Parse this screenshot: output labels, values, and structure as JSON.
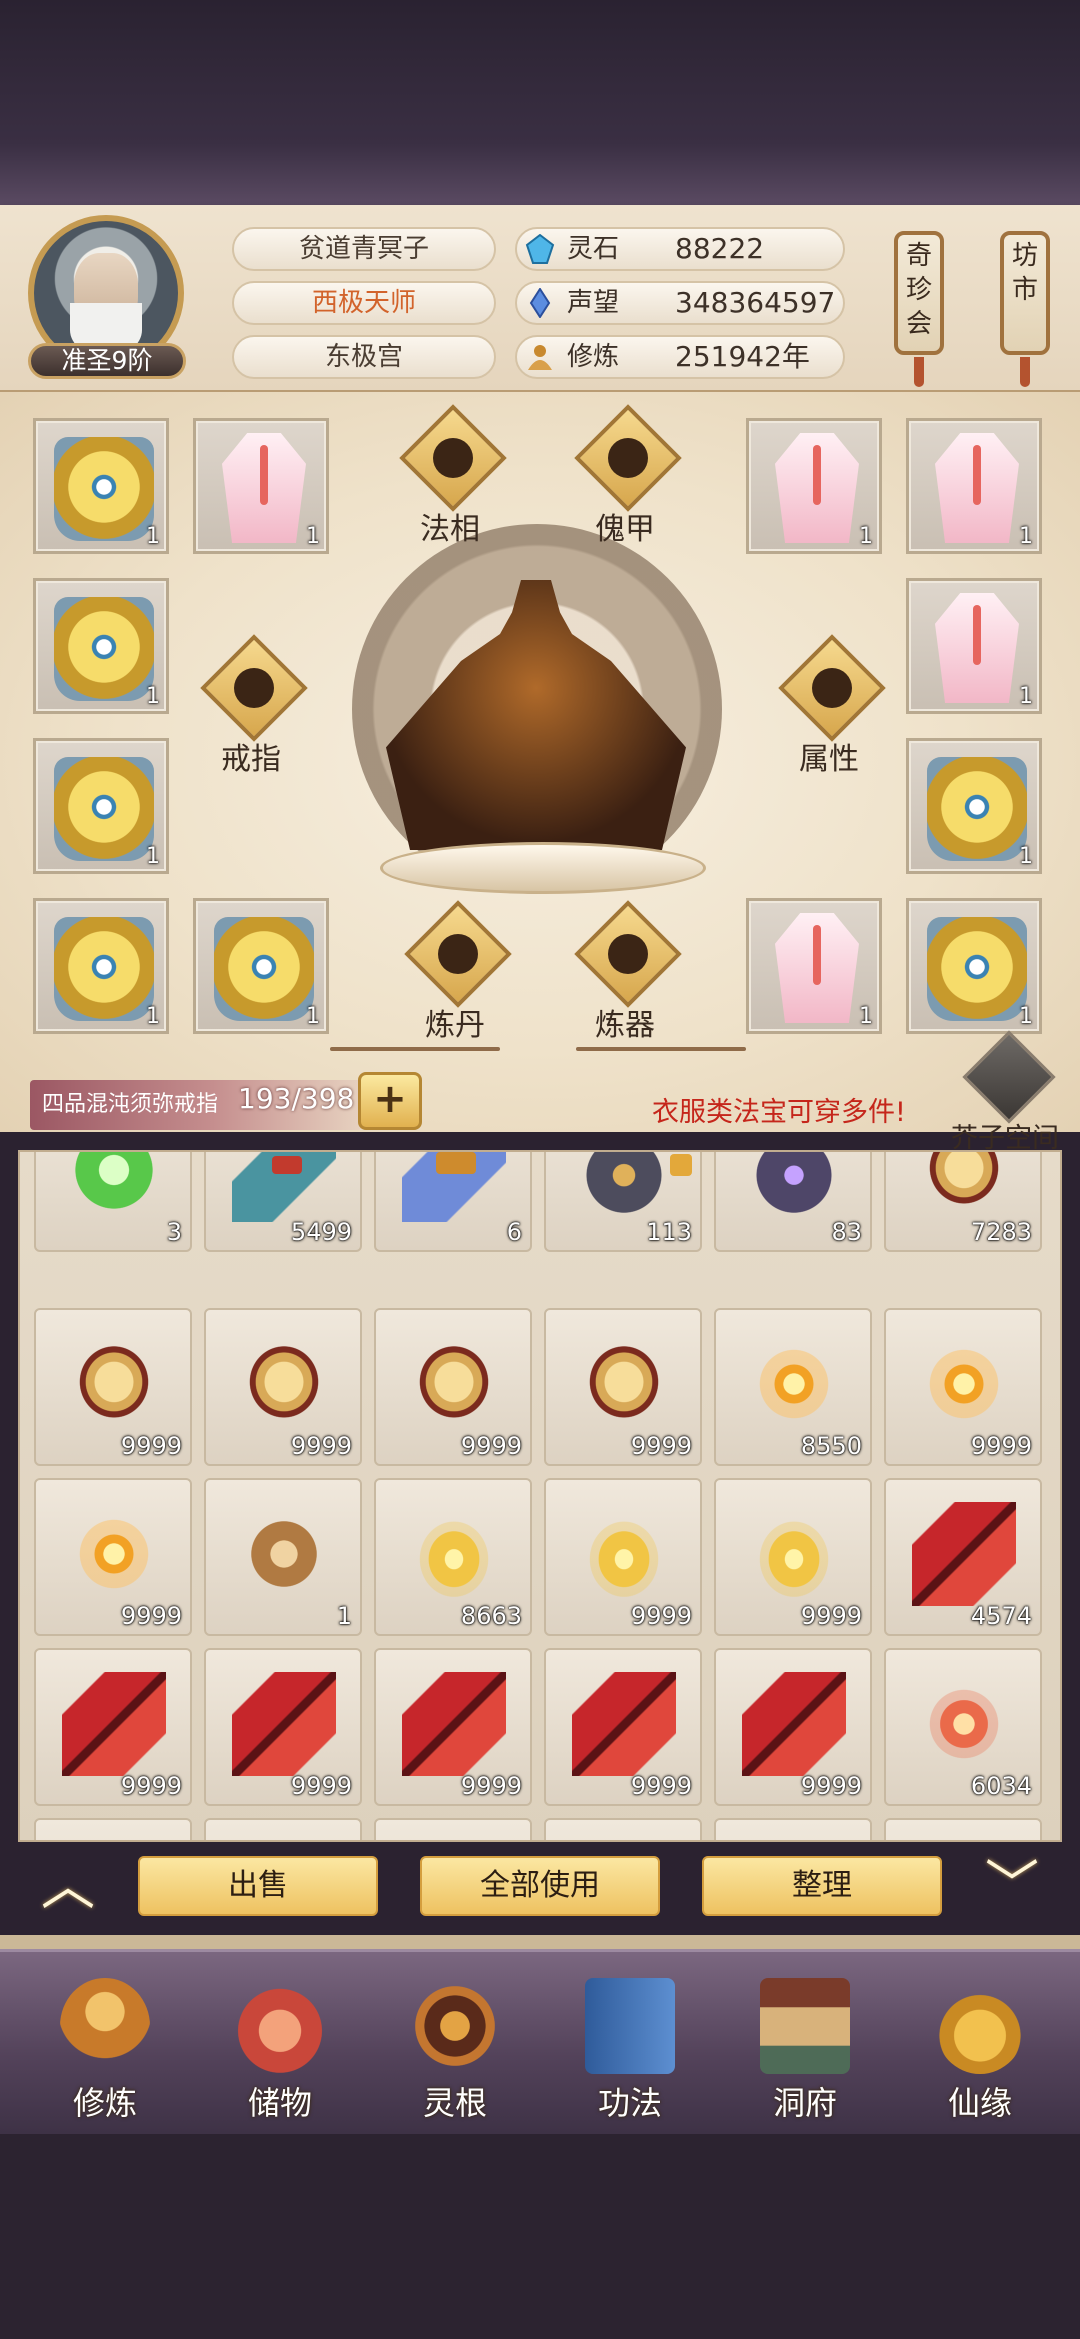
{
  "player": {
    "rank": "准圣9阶",
    "name": "贫道青冥子",
    "title": "西极天师",
    "sect": "东极宫"
  },
  "stats": [
    {
      "label": "灵石",
      "value": "88222",
      "icon": "spirit-stone-icon"
    },
    {
      "label": "声望",
      "value": "348364597",
      "icon": "reputation-icon"
    },
    {
      "label": "修炼",
      "value": "251942年",
      "icon": "cultivation-icon"
    }
  ],
  "side_buttons": {
    "treasure": "奇珍会",
    "market": "坊市"
  },
  "equipment": {
    "center_buttons": {
      "dharma": "法相",
      "puppet": "傀甲",
      "ring": "戒指",
      "attribute": "属性",
      "alchemy": "炼丹",
      "forge": "炼器"
    },
    "slots": [
      {
        "item": "gold-armor",
        "qty": "1"
      },
      {
        "item": "pink-robe",
        "qty": "1"
      },
      {
        "item": "pink-robe",
        "qty": "1"
      },
      {
        "item": "pink-robe",
        "qty": "1"
      },
      {
        "item": "gold-armor",
        "qty": "1"
      },
      {
        "item": "pink-robe",
        "qty": "1"
      },
      {
        "item": "gold-armor",
        "qty": "1"
      },
      {
        "item": "gold-armor",
        "qty": "1"
      },
      {
        "item": "gold-armor",
        "qty": "1"
      },
      {
        "item": "gold-armor",
        "qty": "1"
      },
      {
        "item": "pink-robe",
        "qty": "1"
      },
      {
        "item": "gold-armor",
        "qty": "1"
      }
    ]
  },
  "ring_storage": {
    "name": "四品混沌须弥戒指",
    "capacity": "193/398",
    "add_label": "+"
  },
  "hint": "衣服类法宝可穿多件!",
  "mustard_space": "芥子空间",
  "inventory": [
    {
      "item": "herb",
      "qty": "3"
    },
    {
      "item": "scroll-teal",
      "qty": "5499"
    },
    {
      "item": "scroll-blue",
      "qty": "6"
    },
    {
      "item": "dark-ore",
      "qty": "113"
    },
    {
      "item": "purple-ore",
      "qty": "83"
    },
    {
      "item": "gold-sand",
      "qty": "7283"
    },
    {
      "item": "gold-sand",
      "qty": "9999"
    },
    {
      "item": "gold-sand",
      "qty": "9999"
    },
    {
      "item": "gold-sand",
      "qty": "9999"
    },
    {
      "item": "gold-sand",
      "qty": "9999"
    },
    {
      "item": "fire-drop",
      "qty": "8550"
    },
    {
      "item": "fire-drop",
      "qty": "9999"
    },
    {
      "item": "fire-drop",
      "qty": "9999"
    },
    {
      "item": "dragon-token",
      "qty": "1"
    },
    {
      "item": "golden-cloud",
      "qty": "8663"
    },
    {
      "item": "golden-cloud",
      "qty": "9999"
    },
    {
      "item": "golden-cloud",
      "qty": "9999"
    },
    {
      "item": "red-crystal",
      "qty": "4574"
    },
    {
      "item": "red-crystal",
      "qty": "9999"
    },
    {
      "item": "red-crystal",
      "qty": "9999"
    },
    {
      "item": "red-crystal",
      "qty": "9999"
    },
    {
      "item": "red-crystal",
      "qty": "9999"
    },
    {
      "item": "red-crystal",
      "qty": "9999"
    },
    {
      "item": "flame-wisp",
      "qty": "6034"
    }
  ],
  "actions": {
    "sell": "出售",
    "use_all": "全部使用",
    "sort": "整理"
  },
  "nav": [
    {
      "label": "修炼",
      "icon": "monk-icon"
    },
    {
      "label": "储物",
      "icon": "storage-bag-icon"
    },
    {
      "label": "灵根",
      "icon": "spirit-root-icon"
    },
    {
      "label": "功法",
      "icon": "technique-book-icon"
    },
    {
      "label": "洞府",
      "icon": "cave-mansion-icon"
    },
    {
      "label": "仙缘",
      "icon": "gourd-icon"
    }
  ]
}
